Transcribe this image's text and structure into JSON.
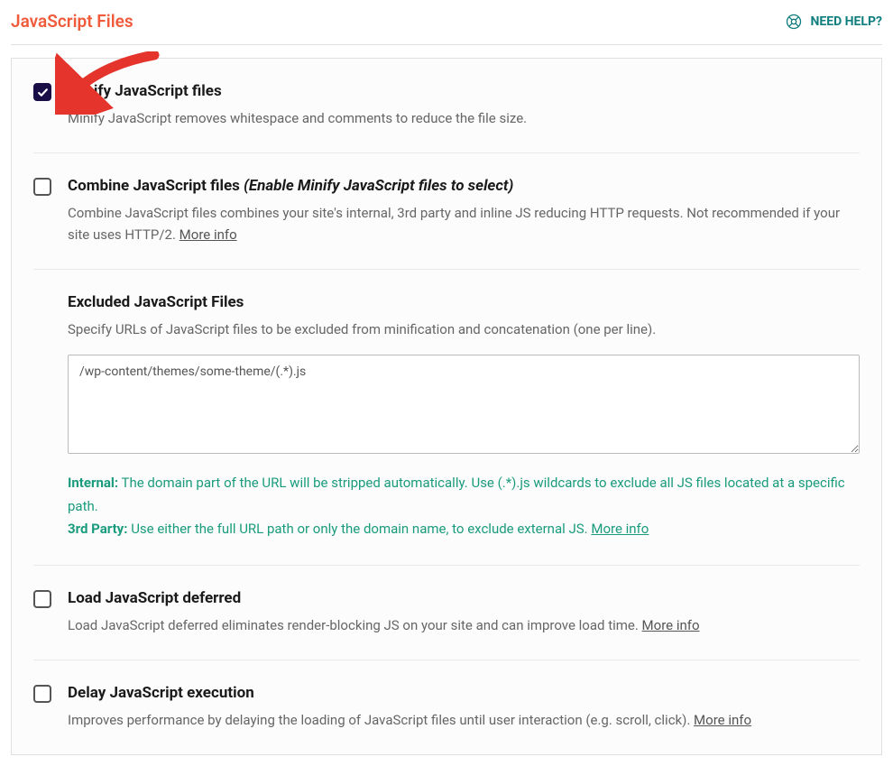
{
  "header": {
    "section_title": "JavaScript Files",
    "help_label": "NEED HELP?"
  },
  "options": {
    "minify": {
      "title": "Minify JavaScript files",
      "desc": "Minify JavaScript removes whitespace and comments to reduce the file size.",
      "checked": true
    },
    "combine": {
      "title": "Combine JavaScript files",
      "title_suffix": "(Enable Minify JavaScript files to select)",
      "desc": "Combine JavaScript files combines your site's internal, 3rd party and inline JS reducing HTTP requests. Not recommended if your site uses HTTP/2. ",
      "more_info": "More info",
      "checked": false
    },
    "excluded": {
      "title": "Excluded JavaScript Files",
      "desc": "Specify URLs of JavaScript files to be excluded from minification and concatenation (one per line).",
      "value": "/wp-content/themes/some-theme/(.*).js",
      "hint_internal_label": "Internal:",
      "hint_internal_text": " The domain part of the URL will be stripped automatically. Use (.*).js wildcards to exclude all JS files located at a specific path.",
      "hint_3rdparty_label": "3rd Party:",
      "hint_3rdparty_text": " Use either the full URL path or only the domain name, to exclude external JS. ",
      "more_info": "More info"
    },
    "defer": {
      "title": "Load JavaScript deferred",
      "desc": "Load JavaScript deferred eliminates render-blocking JS on your site and can improve load time. ",
      "more_info": "More info",
      "checked": false
    },
    "delay": {
      "title": "Delay JavaScript execution",
      "desc": "Improves performance by delaying the loading of JavaScript files until user interaction (e.g. scroll, click). ",
      "more_info": "More info",
      "checked": false
    }
  }
}
